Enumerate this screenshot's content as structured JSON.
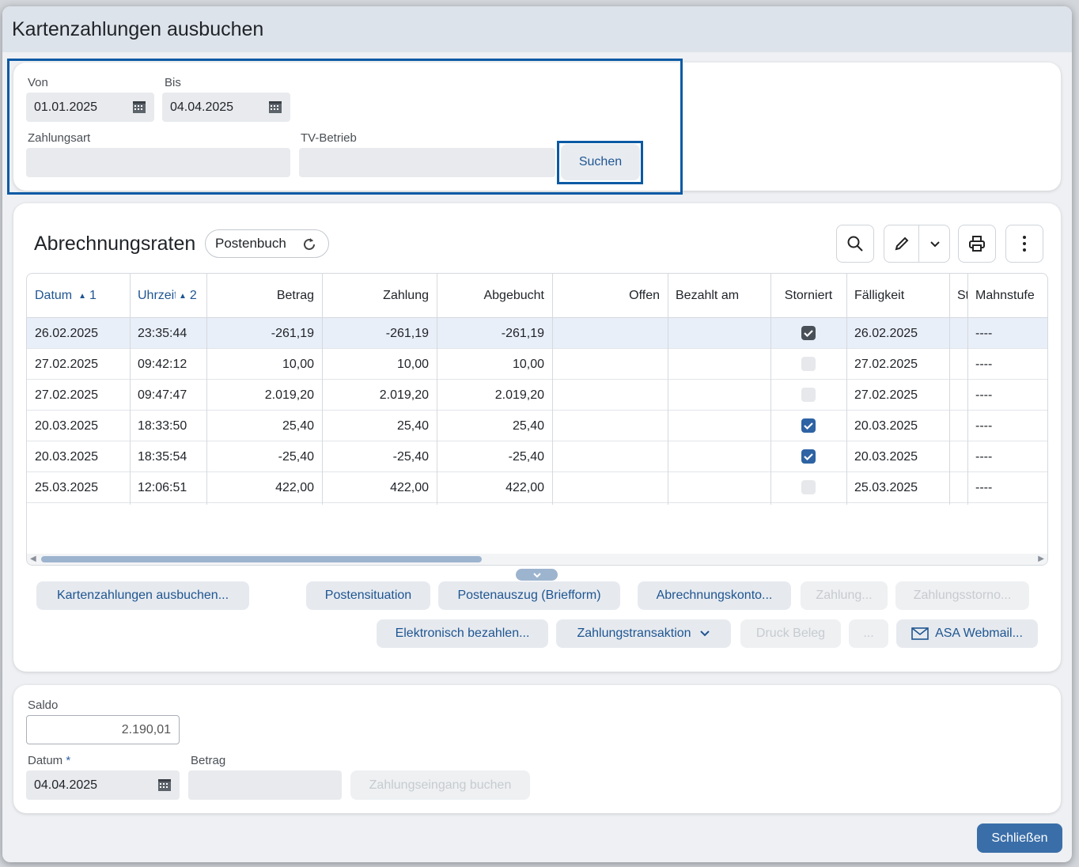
{
  "dialog": {
    "title": "Kartenzahlungen ausbuchen"
  },
  "filter": {
    "von_label": "Von",
    "von_value": "01.01.2025",
    "bis_label": "Bis",
    "bis_value": "04.04.2025",
    "zahlungsart_label": "Zahlungsart",
    "zahlungsart_value": "",
    "tv_label": "TV-Betrieb",
    "tv_value": "",
    "search_button": "Suchen"
  },
  "grid": {
    "title": "Abrechnungsraten",
    "postenbuch_label": "Postenbuch",
    "columns": [
      "Datum",
      "Uhrzeit",
      "Betrag",
      "Zahlung",
      "Abgebucht",
      "Offen",
      "Bezahlt am",
      "Storniert",
      "Fälligkeit",
      "St",
      "Mahnstufe"
    ],
    "sort": {
      "datum": "1",
      "uhrzeit": "2"
    },
    "rows": [
      {
        "datum": "26.02.2025",
        "uhrzeit": "23:35:44",
        "betrag": "-261,19",
        "zahlung": "-261,19",
        "abgebucht": "-261,19",
        "offen": "",
        "bezahlt": "",
        "storniert": true,
        "faelligkeit": "26.02.2025",
        "mahnstufe": "----"
      },
      {
        "datum": "27.02.2025",
        "uhrzeit": "09:42:12",
        "betrag": "10,00",
        "zahlung": "10,00",
        "abgebucht": "10,00",
        "offen": "",
        "bezahlt": "",
        "storniert": false,
        "faelligkeit": "27.02.2025",
        "mahnstufe": "----"
      },
      {
        "datum": "27.02.2025",
        "uhrzeit": "09:47:47",
        "betrag": "2.019,20",
        "zahlung": "2.019,20",
        "abgebucht": "2.019,20",
        "offen": "",
        "bezahlt": "",
        "storniert": false,
        "faelligkeit": "27.02.2025",
        "mahnstufe": "----"
      },
      {
        "datum": "20.03.2025",
        "uhrzeit": "18:33:50",
        "betrag": "25,40",
        "zahlung": "25,40",
        "abgebucht": "25,40",
        "offen": "",
        "bezahlt": "",
        "storniert": true,
        "faelligkeit": "20.03.2025",
        "mahnstufe": "----"
      },
      {
        "datum": "20.03.2025",
        "uhrzeit": "18:35:54",
        "betrag": "-25,40",
        "zahlung": "-25,40",
        "abgebucht": "-25,40",
        "offen": "",
        "bezahlt": "",
        "storniert": true,
        "faelligkeit": "20.03.2025",
        "mahnstufe": "----"
      },
      {
        "datum": "25.03.2025",
        "uhrzeit": "12:06:51",
        "betrag": "422,00",
        "zahlung": "422,00",
        "abgebucht": "422,00",
        "offen": "",
        "bezahlt": "",
        "storniert": false,
        "faelligkeit": "25.03.2025",
        "mahnstufe": "----"
      }
    ]
  },
  "actions": {
    "kartenzahlungen": "Kartenzahlungen ausbuchen...",
    "postensituation": "Postensituation",
    "postenauszug": "Postenauszug (Briefform)",
    "abrechnungskonto": "Abrechnungskonto...",
    "zahlung": "Zahlung...",
    "zahlungsstorno": "Zahlungsstorno...",
    "elektronisch": "Elektronisch bezahlen...",
    "zahlungstransaktion": "Zahlungstransaktion",
    "druck_beleg": "Druck Beleg",
    "more": "...",
    "webmail": "ASA Webmail..."
  },
  "bottom": {
    "saldo_label": "Saldo",
    "saldo_value": "2.190,01",
    "datum_label": "Datum",
    "datum_required": "*",
    "datum_value": "04.04.2025",
    "betrag_label": "Betrag",
    "betrag_value": "",
    "zahlungseingang": "Zahlungseingang buchen"
  },
  "footer": {
    "close": "Schließen"
  },
  "colors": {
    "accent": "#0b5aa4",
    "link": "#1f5591",
    "primary": "#3a6ea8"
  }
}
